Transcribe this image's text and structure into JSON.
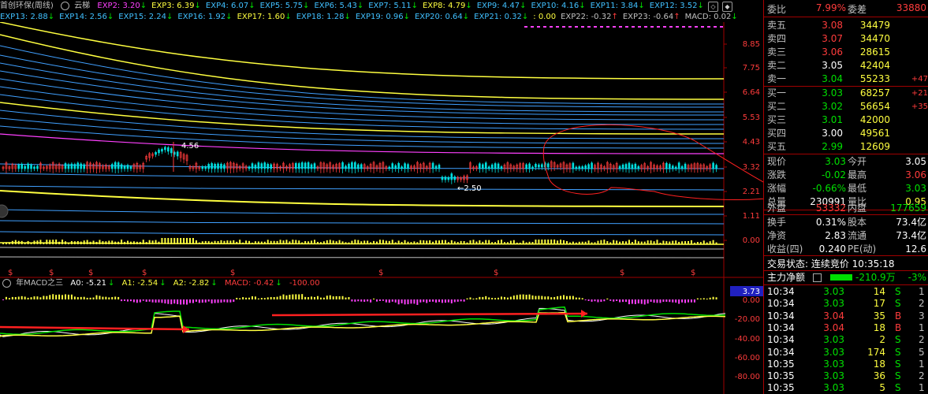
{
  "header": {
    "title": "首创环保(周线)",
    "indicator": "云梯",
    "line1": [
      {
        "label": "EXP2: 3.20",
        "color": "#ff40ff",
        "dir": "down"
      },
      {
        "label": "EXP3: 6.39",
        "color": "#ffff40",
        "dir": "down"
      },
      {
        "label": "EXP4: 6.07",
        "color": "#40c0ff",
        "dir": "down"
      },
      {
        "label": "EXP5: 5.75",
        "color": "#40c0ff",
        "dir": "down"
      },
      {
        "label": "EXP6: 5.43",
        "color": "#40c0ff",
        "dir": "down"
      },
      {
        "label": "EXP7: 5.11",
        "color": "#40c0ff",
        "dir": "down"
      },
      {
        "label": "EXP8: 4.79",
        "color": "#ffff40",
        "dir": "down"
      },
      {
        "label": "EXP9: 4.47",
        "color": "#40c0ff",
        "dir": "down"
      },
      {
        "label": "EXP10: 4.16",
        "color": "#40c0ff",
        "dir": "down"
      },
      {
        "label": "EXP11: 3.84",
        "color": "#40c0ff",
        "dir": "down"
      },
      {
        "label": "EXP12: 3.52",
        "color": "#40c0ff",
        "dir": "down"
      }
    ],
    "line2": [
      {
        "label": "EXP13: 2.88",
        "color": "#40c0ff",
        "dir": "down"
      },
      {
        "label": "EXP14: 2.56",
        "color": "#40c0ff",
        "dir": "down"
      },
      {
        "label": "EXP15: 2.24",
        "color": "#40c0ff",
        "dir": "down"
      },
      {
        "label": "EXP16: 1.92",
        "color": "#40c0ff",
        "dir": "down"
      },
      {
        "label": "EXP17: 1.60",
        "color": "#ffff40",
        "dir": "down"
      },
      {
        "label": "EXP18: 1.28",
        "color": "#40c0ff",
        "dir": "down"
      },
      {
        "label": "EXP19: 0.96",
        "color": "#40c0ff",
        "dir": "down"
      },
      {
        "label": "EXP20: 0.64",
        "color": "#40c0ff",
        "dir": "down"
      },
      {
        "label": "EXP21: 0.32",
        "color": "#40c0ff",
        "dir": "down"
      },
      {
        "label": ": 0.00",
        "color": "#ffff40",
        "dir": ""
      },
      {
        "label": "EXP22: -0.32",
        "color": "#c0c0c0",
        "dir": "up"
      },
      {
        "label": "EXP23: -0.64",
        "color": "#c0c0c0",
        "dir": "up"
      },
      {
        "label": "MACD: 0.02",
        "color": "#c0c0c0",
        "dir": "down"
      }
    ]
  },
  "price_axis": [
    "8.85",
    "7.75",
    "6.64",
    "5.53",
    "4.43",
    "3.32",
    "2.21",
    "1.11",
    "0.00"
  ],
  "annotations": {
    "high_label": "4.56",
    "low_label": "2.50"
  },
  "macd_header": {
    "name": "年MACD之三",
    "a0": "A0: -5.21",
    "a1": "A1: -2.54",
    "a2": "A2: -2.82",
    "macd": "MACD: -0.42",
    "extra": "-100.00"
  },
  "macd_axis": [
    "3.73",
    "0.00",
    "-20.00",
    "-40.00",
    "-60.00",
    "-80.00"
  ],
  "right_panel": {
    "weibi": {
      "label": "委比",
      "value": "7.99%",
      "label2": "委差",
      "value2": "33880"
    },
    "asks": [
      {
        "label": "卖五",
        "price": "3.08",
        "vol": "34479",
        "chg": ""
      },
      {
        "label": "卖四",
        "price": "3.07",
        "vol": "34470",
        "chg": ""
      },
      {
        "label": "卖三",
        "price": "3.06",
        "vol": "28615",
        "chg": ""
      },
      {
        "label": "卖二",
        "price": "3.05",
        "vol": "42404",
        "chg": ""
      },
      {
        "label": "卖一",
        "price": "3.04",
        "vol": "55233",
        "chg": "+47"
      }
    ],
    "bids": [
      {
        "label": "买一",
        "price": "3.03",
        "vol": "68257",
        "chg": "+21"
      },
      {
        "label": "买二",
        "price": "3.02",
        "vol": "56654",
        "chg": "+35"
      },
      {
        "label": "买三",
        "price": "3.01",
        "vol": "42000",
        "chg": ""
      },
      {
        "label": "买四",
        "price": "3.00",
        "vol": "49561",
        "chg": ""
      },
      {
        "label": "买五",
        "price": "2.99",
        "vol": "12609",
        "chg": ""
      }
    ],
    "stats": [
      {
        "l1": "现价",
        "v1": "3.03",
        "l2": "今开",
        "v2": "3.05"
      },
      {
        "l1": "涨跌",
        "v1": "-0.02",
        "l2": "最高",
        "v2": "3.06"
      },
      {
        "l1": "涨幅",
        "v1": "-0.66%",
        "l2": "最低",
        "v2": "3.03"
      },
      {
        "l1": "总量",
        "v1": "230991",
        "l2": "量比",
        "v2": "0.95"
      }
    ],
    "stats2": [
      {
        "l1": "外盘",
        "v1": "53332",
        "l2": "内盘",
        "v2": "177659"
      }
    ],
    "stats3": [
      {
        "l1": "换手",
        "v1": "0.31%",
        "l2": "股本",
        "v2": "73.4亿"
      },
      {
        "l1": "净资",
        "v1": "2.83",
        "l2": "流通",
        "v2": "73.4亿"
      },
      {
        "l1": "收益(四)",
        "v1": "0.240",
        "l2": "PE(动)",
        "v2": "12.6"
      }
    ],
    "trade_status": "交易状态: 连续竞价 10:35:18",
    "main_flow": {
      "label": "主力净额",
      "value": "-210.9万",
      "pct": "-3%"
    },
    "ticks": [
      {
        "time": "10:34",
        "price": "3.03",
        "vol": "14",
        "side": "S",
        "n": "1"
      },
      {
        "time": "10:34",
        "price": "3.03",
        "vol": "17",
        "side": "S",
        "n": "2"
      },
      {
        "time": "10:34",
        "price": "3.04",
        "vol": "35",
        "side": "B",
        "n": "3"
      },
      {
        "time": "10:34",
        "price": "3.04",
        "vol": "18",
        "side": "B",
        "n": "1"
      },
      {
        "time": "10:34",
        "price": "3.03",
        "vol": "2",
        "side": "S",
        "n": "2"
      },
      {
        "time": "10:34",
        "price": "3.03",
        "vol": "174",
        "side": "S",
        "n": "5"
      },
      {
        "time": "10:35",
        "price": "3.03",
        "vol": "18",
        "side": "S",
        "n": "1"
      },
      {
        "time": "10:35",
        "price": "3.03",
        "vol": "36",
        "side": "S",
        "n": "2"
      },
      {
        "time": "10:35",
        "price": "3.03",
        "vol": "5",
        "side": "S",
        "n": "1"
      }
    ]
  }
}
